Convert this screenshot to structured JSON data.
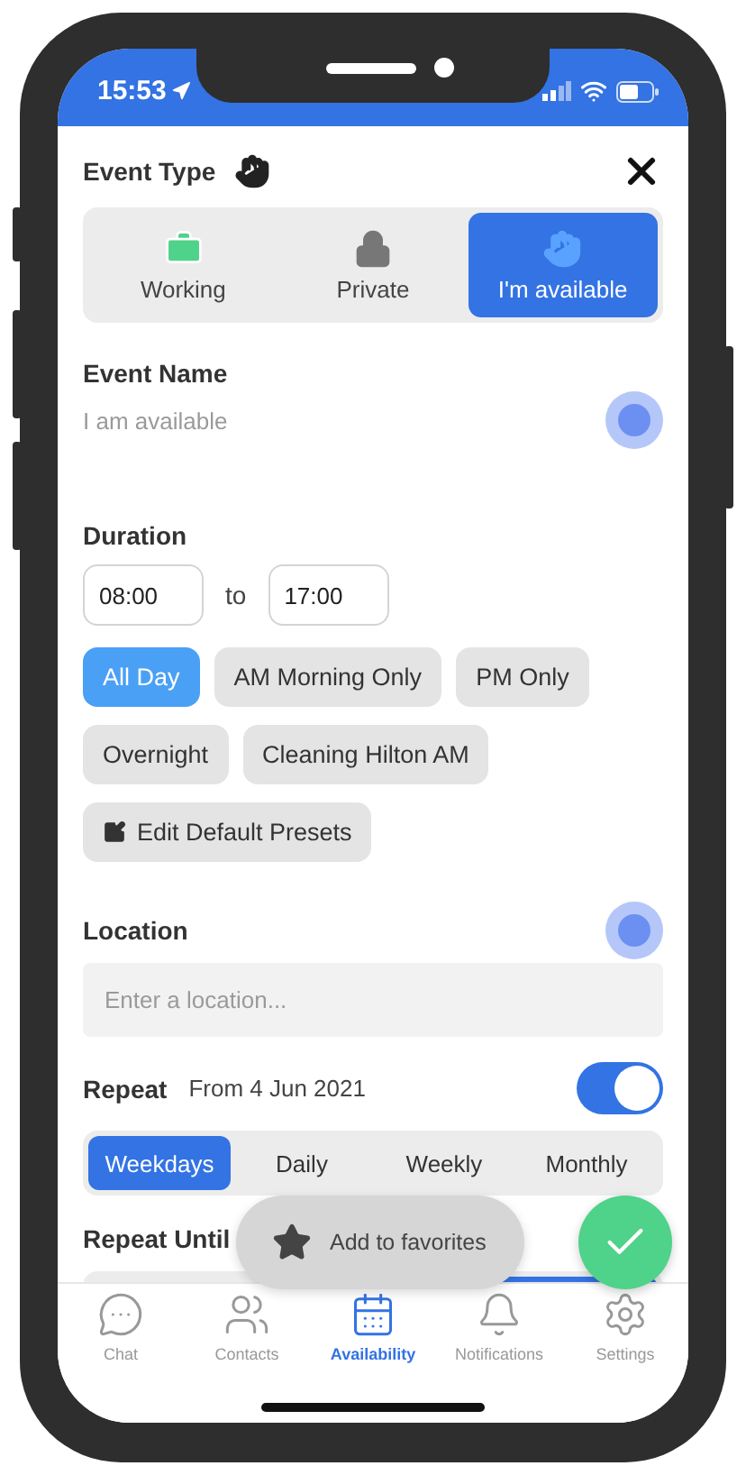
{
  "status_bar": {
    "time": "15:53"
  },
  "event_type": {
    "title": "Event Type",
    "options": [
      {
        "label": "Working",
        "kind": "briefcase",
        "selected": false
      },
      {
        "label": "Private",
        "kind": "lock",
        "selected": false
      },
      {
        "label": "I'm available",
        "kind": "hand",
        "selected": true
      }
    ]
  },
  "event_name": {
    "label": "Event Name",
    "placeholder": "I am available"
  },
  "duration": {
    "label": "Duration",
    "start": "08:00",
    "separator": "to",
    "end": "17:00",
    "presets": [
      {
        "label": "All Day",
        "selected": true
      },
      {
        "label": "AM Morning Only",
        "selected": false
      },
      {
        "label": "PM Only",
        "selected": false
      },
      {
        "label": "Overnight",
        "selected": false
      },
      {
        "label": "Cleaning Hilton AM",
        "selected": false
      }
    ],
    "edit_button": "Edit Default Presets"
  },
  "location": {
    "label": "Location",
    "placeholder": "Enter a location..."
  },
  "repeat": {
    "label": "Repeat",
    "from": "From 4 Jun 2021",
    "on": true,
    "options": [
      {
        "label": "Weekdays",
        "selected": true
      },
      {
        "label": "Daily",
        "selected": false
      },
      {
        "label": "Weekly",
        "selected": false
      },
      {
        "label": "Monthly",
        "selected": false
      }
    ]
  },
  "repeat_until": {
    "label": "Repeat Until"
  },
  "favorites_button": "Add to favorites",
  "nav": [
    {
      "label": "Chat",
      "kind": "chat",
      "selected": false
    },
    {
      "label": "Contacts",
      "kind": "contacts",
      "selected": false
    },
    {
      "label": "Availability",
      "kind": "calendar",
      "selected": true
    },
    {
      "label": "Notifications",
      "kind": "bell",
      "selected": false
    },
    {
      "label": "Settings",
      "kind": "gear",
      "selected": false
    }
  ]
}
